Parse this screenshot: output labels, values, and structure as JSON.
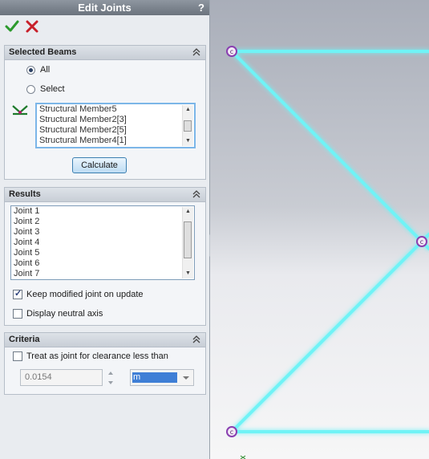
{
  "title": "Edit Joints",
  "help_glyph": "?",
  "selected_beams": {
    "header": "Selected Beams",
    "radio_all": "All",
    "radio_select": "Select",
    "members": [
      "Structural Member5",
      "Structural Member2[3]",
      "Structural Member2[5]",
      "Structural Member4[1]"
    ],
    "calculate_label": "Calculate"
  },
  "results": {
    "header": "Results",
    "joints": [
      "Joint 1",
      "Joint 2",
      "Joint 3",
      "Joint 4",
      "Joint 5",
      "Joint 6",
      "Joint 7"
    ],
    "keep_modified_label": "Keep modified joint on update",
    "keep_modified_checked": true,
    "display_neutral_label": "Display neutral axis",
    "display_neutral_checked": false
  },
  "criteria": {
    "header": "Criteria",
    "treat_as_joint_label": "Treat as joint for clearance less than",
    "treat_as_joint_checked": false,
    "clearance_value": "0.0154",
    "unit_value": "m"
  },
  "colors": {
    "beam": "#6ff3f6",
    "endpoint": "#8a3fb0",
    "panel_bg": "#e9ecf0"
  }
}
